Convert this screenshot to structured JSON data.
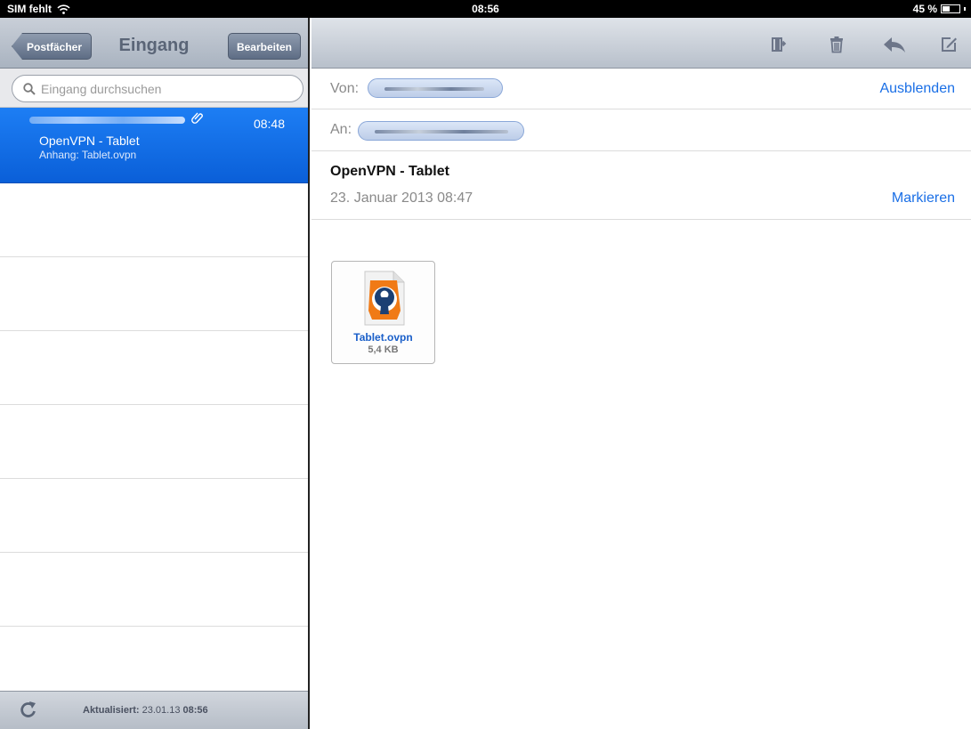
{
  "status_bar": {
    "carrier": "SIM fehlt",
    "time": "08:56",
    "battery": "45 %",
    "battery_level": 0.45
  },
  "sidebar": {
    "back_label": "Postfächer",
    "title": "Eingang",
    "edit_label": "Bearbeiten",
    "search_placeholder": "Eingang durchsuchen",
    "messages": [
      {
        "time": "08:48",
        "subject": "OpenVPN - Tablet",
        "preview": "Anhang: Tablet.ovpn",
        "has_attachment": true,
        "selected": true
      }
    ],
    "footer": {
      "updated_label": "Aktualisiert:",
      "updated_date": "23.01.13",
      "updated_time": "08:56"
    }
  },
  "message": {
    "from_label": "Von:",
    "to_label": "An:",
    "hide_link": "Ausblenden",
    "subject": "OpenVPN - Tablet",
    "date": "23. Januar 2013 08:47",
    "mark_link": "Markieren",
    "attachment": {
      "name": "Tablet.ovpn",
      "size": "5,4 KB"
    }
  },
  "toolbar": {
    "icons": [
      "move-folder-icon",
      "trash-icon",
      "reply-icon",
      "compose-icon"
    ]
  },
  "colors": {
    "accent": "#1a6fe6",
    "selection": "#0a64dc"
  }
}
